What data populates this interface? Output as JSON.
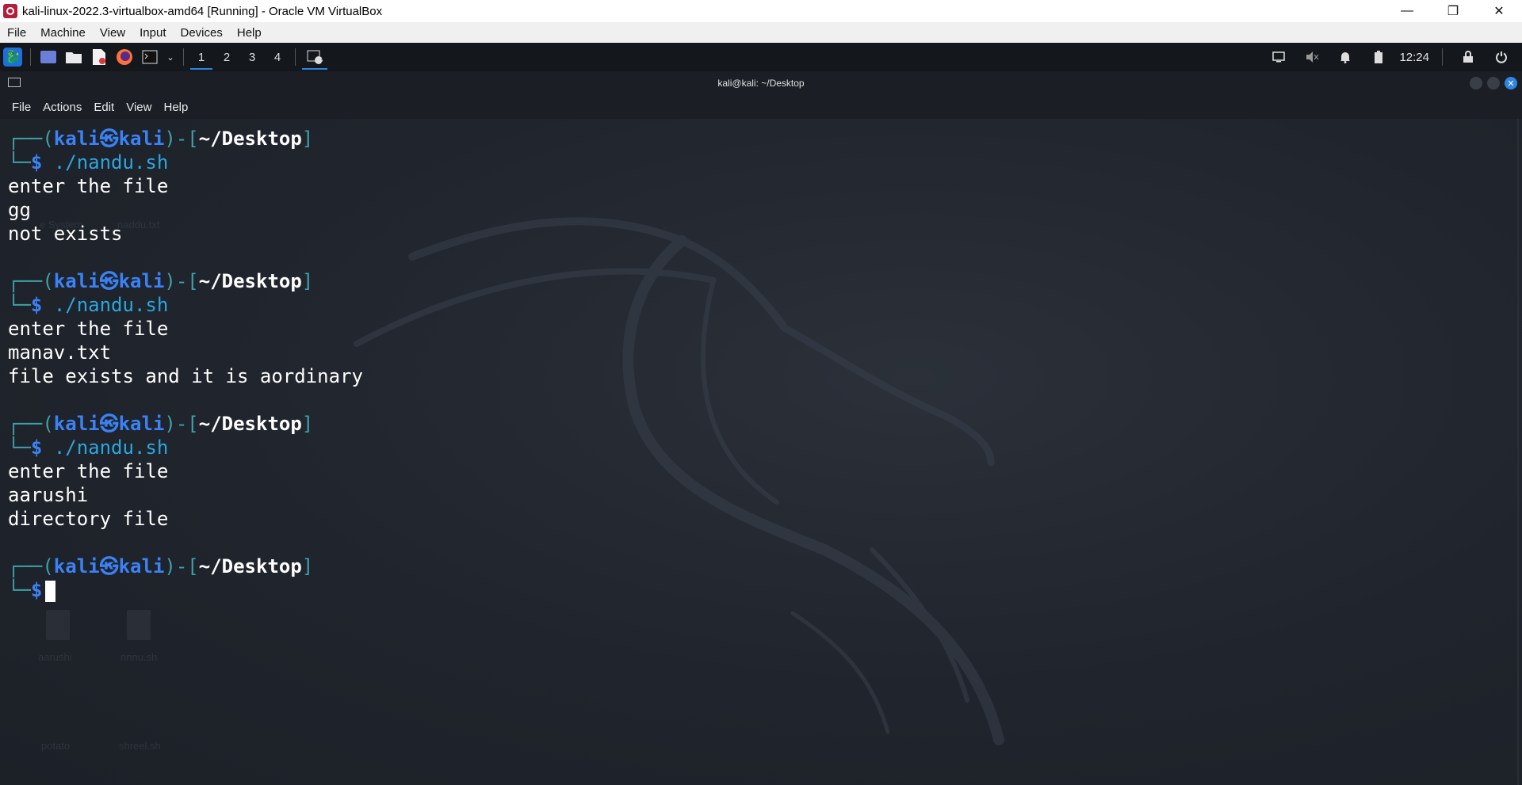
{
  "vbox": {
    "title": "kali-linux-2022.3-virtualbox-amd64 [Running] - Oracle VM VirtualBox",
    "controls": {
      "minimize": "—",
      "restore": "❐",
      "close": "✕"
    },
    "menu": [
      "File",
      "Machine",
      "View",
      "Input",
      "Devices",
      "Help"
    ]
  },
  "panel": {
    "workspaces": [
      "1",
      "2",
      "3",
      "4"
    ],
    "active_workspace": "1",
    "badge": "2",
    "clock": "12:24"
  },
  "terminal": {
    "title": "kali@kali: ~/Desktop",
    "menu": [
      "File",
      "Actions",
      "Edit",
      "View",
      "Help"
    ],
    "user": "kali",
    "at_symbol": "㉿",
    "host": "kali",
    "cwd": "~/Desktop",
    "blocks": [
      {
        "cmd": "./nandu.sh",
        "output": [
          "enter the file",
          "gg",
          "not exists"
        ]
      },
      {
        "cmd": "./nandu.sh",
        "output": [
          "enter the file",
          "manav.txt",
          "file exists and it is aordinary"
        ]
      },
      {
        "cmd": "./nandu.sh",
        "output": [
          "enter the file",
          "aarushi",
          "directory file"
        ]
      }
    ]
  },
  "desktop_ghost_icons": [
    "e System",
    "naddu.txt",
    "aarushi",
    "nnnu.sh",
    "potato",
    "shreel.sh"
  ]
}
